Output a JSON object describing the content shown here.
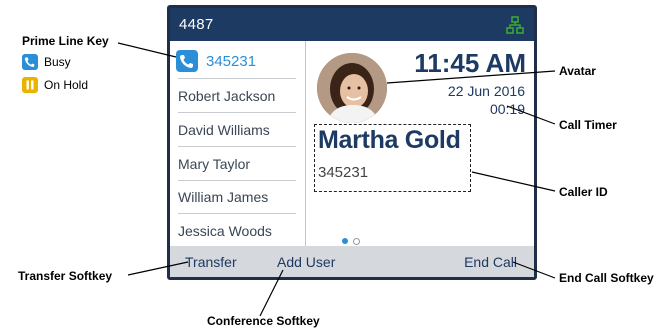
{
  "screen": {
    "title": "4487",
    "network_icon": "network-icon",
    "prime_line": {
      "number": "345231",
      "icon": "phone-icon",
      "color": "#2a8fd6"
    },
    "lines": [
      "Robert Jackson",
      "David Williams",
      "Mary Taylor",
      "William James",
      "Jessica Woods"
    ],
    "time": "11:45 AM",
    "date": "22 Jun 2016",
    "call_timer": "00:19",
    "caller_name": "Martha Gold",
    "caller_number": "345231",
    "softkeys": {
      "transfer": "Transfer",
      "add_user": "Add User",
      "end_call": "End Call"
    }
  },
  "callouts": {
    "prime_line_key": "Prime Line Key",
    "busy": "Busy",
    "on_hold": "On Hold",
    "avatar": "Avatar",
    "call_timer": "Call Timer",
    "caller_id": "Caller ID",
    "transfer_softkey": "Transfer Softkey",
    "conference_softkey": "Conference Softkey",
    "end_call_softkey": "End Call Softkey"
  },
  "colors": {
    "header": "#1d3a63",
    "accent": "#2a8fd6",
    "hold": "#e8b400",
    "softbar": "#d5d8dc",
    "network": "#3aa635"
  }
}
